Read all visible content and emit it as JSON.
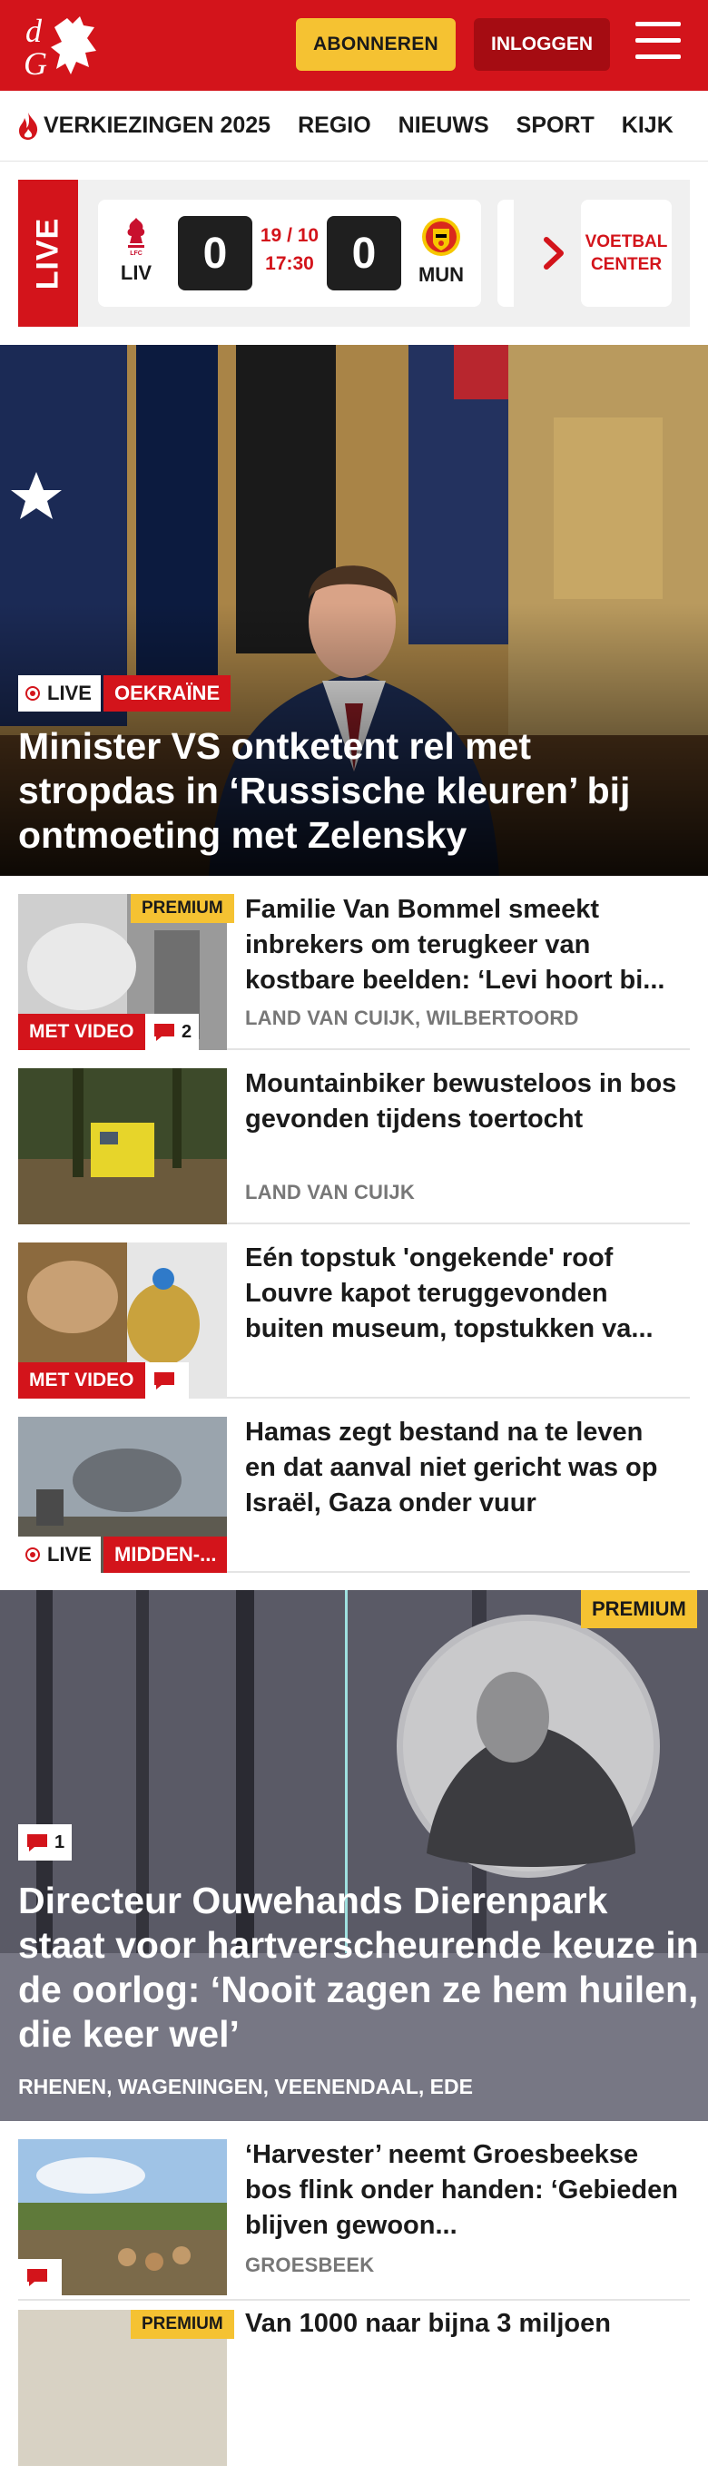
{
  "header": {
    "logo_text": "dG",
    "subscribe_label": "ABONNEREN",
    "login_label": "INLOGGEN",
    "menu_icon": "hamburger-menu-icon"
  },
  "nav": {
    "items": [
      {
        "label": "VERKIEZINGEN 2025",
        "icon": "flame-icon"
      },
      {
        "label": "REGIO"
      },
      {
        "label": "NIEUWS"
      },
      {
        "label": "SPORT"
      },
      {
        "label": "KIJK"
      }
    ]
  },
  "live_bar": {
    "label": "LIVE",
    "match": {
      "home": "LIV",
      "home_score": "0",
      "date": "19 / 10",
      "time": "17:30",
      "away_score": "0",
      "away": "MUN"
    },
    "link_label_1": "VOETBAL",
    "link_label_2": "CENTER"
  },
  "hero": {
    "live_label": "LIVE",
    "category": "OEKRAÏNE",
    "title": "Minister VS ontketent rel met stropdas in ‘Russische kleuren’ bij ontmoeting met Zelensky"
  },
  "articles": [
    {
      "title": "Familie Van Bommel smeekt inbrekers om terugkeer van kostbare beelden: ‘Levi hoort bi...",
      "location": "LAND VAN CUIJK, WILBERTOORD",
      "premium": "PREMIUM",
      "video": "MET VIDEO",
      "comments": "2"
    },
    {
      "title": "Mountainbiker bewusteloos in bos gevonden tijdens toertocht",
      "location": "LAND VAN CUIJK"
    },
    {
      "title": "Eén topstuk 'ongekende' roof Louvre kapot teruggevonden buiten museum, topstukken va...",
      "location": "",
      "video": "MET VIDEO",
      "comments": ""
    },
    {
      "title": "Hamas zegt bestand na te leven en dat aanval niet gericht was op Israël, Gaza onder vuur",
      "location": "",
      "live": "LIVE",
      "category": "MIDDEN-..."
    }
  ],
  "feature": {
    "premium": "PREMIUM",
    "comments": "1",
    "title": "Directeur Ouwehands Dierenpark staat voor hartverscheurende keuze in de oorlog: ‘Nooit zagen ze hem huilen, die keer wel’",
    "location": "RHENEN, WAGENINGEN, VEENENDAAL, EDE"
  },
  "more_articles": [
    {
      "title": "‘Harvester’ neemt Groesbeekse bos flink onder handen: ‘Gebieden blijven gewoon...",
      "location": "GROESBEEK",
      "comments": ""
    },
    {
      "premium": "PREMIUM",
      "title": "Van 1000 naar bijna 3 miljoen"
    }
  ],
  "colors": {
    "brand_red": "#d3141b",
    "accent_yellow": "#f5c232",
    "dark_red": "#a50c12"
  }
}
